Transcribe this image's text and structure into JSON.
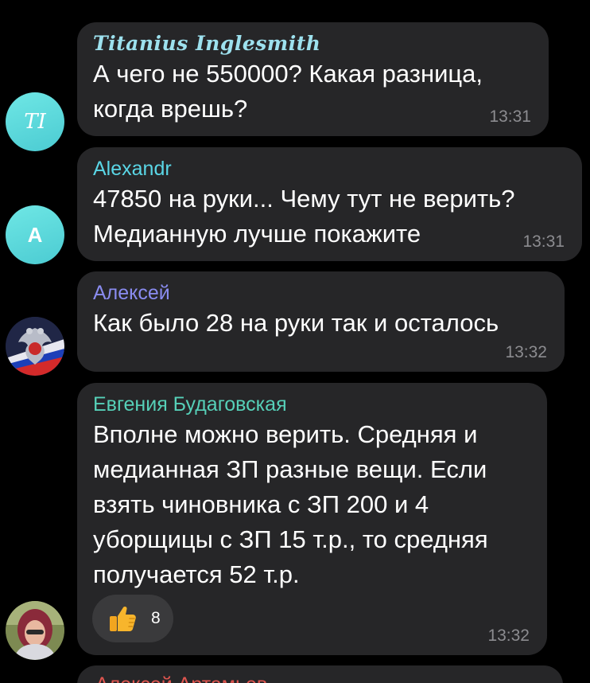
{
  "colors": {
    "background": "#000000",
    "bubble": "#262628",
    "text": "#ffffff",
    "time": "#8c8c90",
    "reaction_bg": "#3a3a3c"
  },
  "messages": [
    {
      "sender": "Titanius Inglesmith",
      "sender_color": "#9de1ee",
      "avatar_initials": "TI",
      "avatar_color": "#5fd8dc",
      "text": "А чего не 550000? Какая разница,\nкогда врешь?",
      "time": "13:31"
    },
    {
      "sender": "Alexandr",
      "sender_color": "#5ad6e6",
      "avatar_initials": "A",
      "avatar_color": "#62d9de",
      "text": "47850 на руки... Чему тут не верить?\nМедианную лучше покажите",
      "time": "13:31"
    },
    {
      "sender": "Алексей",
      "sender_color": "#8a8cf0",
      "avatar_icon": "coat-of-arms-avatar",
      "text": "Как было 28 на руки так и осталось",
      "time": "13:32"
    },
    {
      "sender": "Евгения Будаговская",
      "sender_color": "#56d0b8",
      "avatar_icon": "profile-photo-avatar",
      "text": "Вполне можно верить. Средняя и\nмедианная ЗП разные вещи. Если\nвзять чиновника с ЗП 200 и 4\nуборщицы с ЗП 15 т.р., то средняя\nполучается 52 т.р.",
      "reaction": {
        "emoji": "thumbs-up-icon",
        "count": "8"
      },
      "time": "13:32"
    }
  ],
  "next_message": {
    "sender": "Алексей Артамьев",
    "sender_color": "#e0554f"
  }
}
